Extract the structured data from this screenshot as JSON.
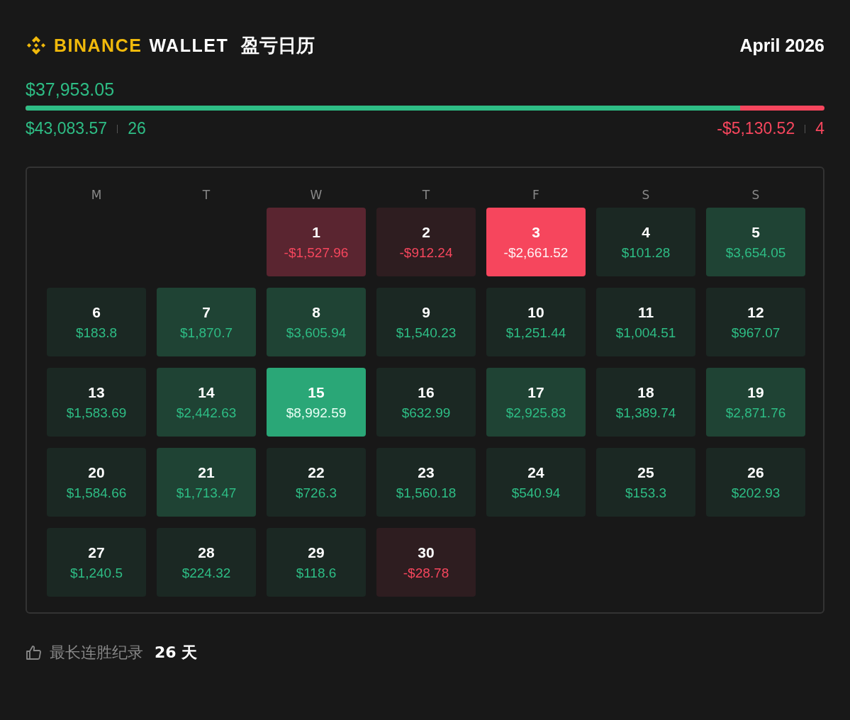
{
  "header": {
    "brand": "BINANCE",
    "product": "WALLET",
    "title": "盈亏日历",
    "month": "April 2026"
  },
  "summary": {
    "net": "$37,953.05",
    "profit_total": "$43,083.57",
    "profit_days": "26",
    "loss_total": "-$5,130.52",
    "loss_days": "4",
    "level": 0.894
  },
  "weekdays": [
    "M",
    "T",
    "W",
    "T",
    "F",
    "S",
    "S"
  ],
  "weeks": [
    [
      {
        "kind": "blank"
      },
      {
        "kind": "blank"
      },
      {
        "day": "1",
        "value": "-$1,527.96",
        "kind": "loss",
        "color": "#5a2530"
      },
      {
        "day": "2",
        "value": "-$912.24",
        "kind": "loss",
        "color": "#2e1d20"
      },
      {
        "day": "3",
        "value": "-$2,661.52",
        "kind": "worst",
        "color": "#f6465d"
      },
      {
        "day": "4",
        "value": "$101.28",
        "kind": "gain",
        "color": "#1b2823"
      },
      {
        "day": "5",
        "value": "$3,654.05",
        "kind": "gain",
        "color": "#1f4334"
      }
    ],
    [
      {
        "day": "6",
        "value": "$183.8",
        "kind": "gain",
        "color": "#1b2823"
      },
      {
        "day": "7",
        "value": "$1,870.7",
        "kind": "gain",
        "color": "#1f4334"
      },
      {
        "day": "8",
        "value": "$3,605.94",
        "kind": "gain",
        "color": "#1f4334"
      },
      {
        "day": "9",
        "value": "$1,540.23",
        "kind": "gain",
        "color": "#1b2823"
      },
      {
        "day": "10",
        "value": "$1,251.44",
        "kind": "gain",
        "color": "#1b2823"
      },
      {
        "day": "11",
        "value": "$1,004.51",
        "kind": "gain",
        "color": "#1b2823"
      },
      {
        "day": "12",
        "value": "$967.07",
        "kind": "gain",
        "color": "#1b2823"
      }
    ],
    [
      {
        "day": "13",
        "value": "$1,583.69",
        "kind": "gain",
        "color": "#1b2823"
      },
      {
        "day": "14",
        "value": "$2,442.63",
        "kind": "gain",
        "color": "#1f4334"
      },
      {
        "day": "15",
        "value": "$8,992.59",
        "kind": "best",
        "color": "#2aa777"
      },
      {
        "day": "16",
        "value": "$632.99",
        "kind": "gain",
        "color": "#1b2823"
      },
      {
        "day": "17",
        "value": "$2,925.83",
        "kind": "gain",
        "color": "#1f4334"
      },
      {
        "day": "18",
        "value": "$1,389.74",
        "kind": "gain",
        "color": "#1b2823"
      },
      {
        "day": "19",
        "value": "$2,871.76",
        "kind": "gain",
        "color": "#1f4334"
      }
    ],
    [
      {
        "day": "20",
        "value": "$1,584.66",
        "kind": "gain",
        "color": "#1b2823"
      },
      {
        "day": "21",
        "value": "$1,713.47",
        "kind": "gain",
        "color": "#1f4334"
      },
      {
        "day": "22",
        "value": "$726.3",
        "kind": "gain",
        "color": "#1b2823"
      },
      {
        "day": "23",
        "value": "$1,560.18",
        "kind": "gain",
        "color": "#1b2823"
      },
      {
        "day": "24",
        "value": "$540.94",
        "kind": "gain",
        "color": "#1b2823"
      },
      {
        "day": "25",
        "value": "$153.3",
        "kind": "gain",
        "color": "#1b2823"
      },
      {
        "day": "26",
        "value": "$202.93",
        "kind": "gain",
        "color": "#1b2823"
      }
    ],
    [
      {
        "day": "27",
        "value": "$1,240.5",
        "kind": "gain",
        "color": "#1b2823"
      },
      {
        "day": "28",
        "value": "$224.32",
        "kind": "gain",
        "color": "#1b2823"
      },
      {
        "day": "29",
        "value": "$118.6",
        "kind": "gain",
        "color": "#1b2823"
      },
      {
        "day": "30",
        "value": "-$28.78",
        "kind": "loss",
        "color": "#2e1d20"
      },
      {
        "kind": "blank"
      },
      {
        "kind": "blank"
      },
      {
        "kind": "blank"
      }
    ]
  ],
  "streak": {
    "label": "最长连胜纪录",
    "value": "26 天"
  }
}
